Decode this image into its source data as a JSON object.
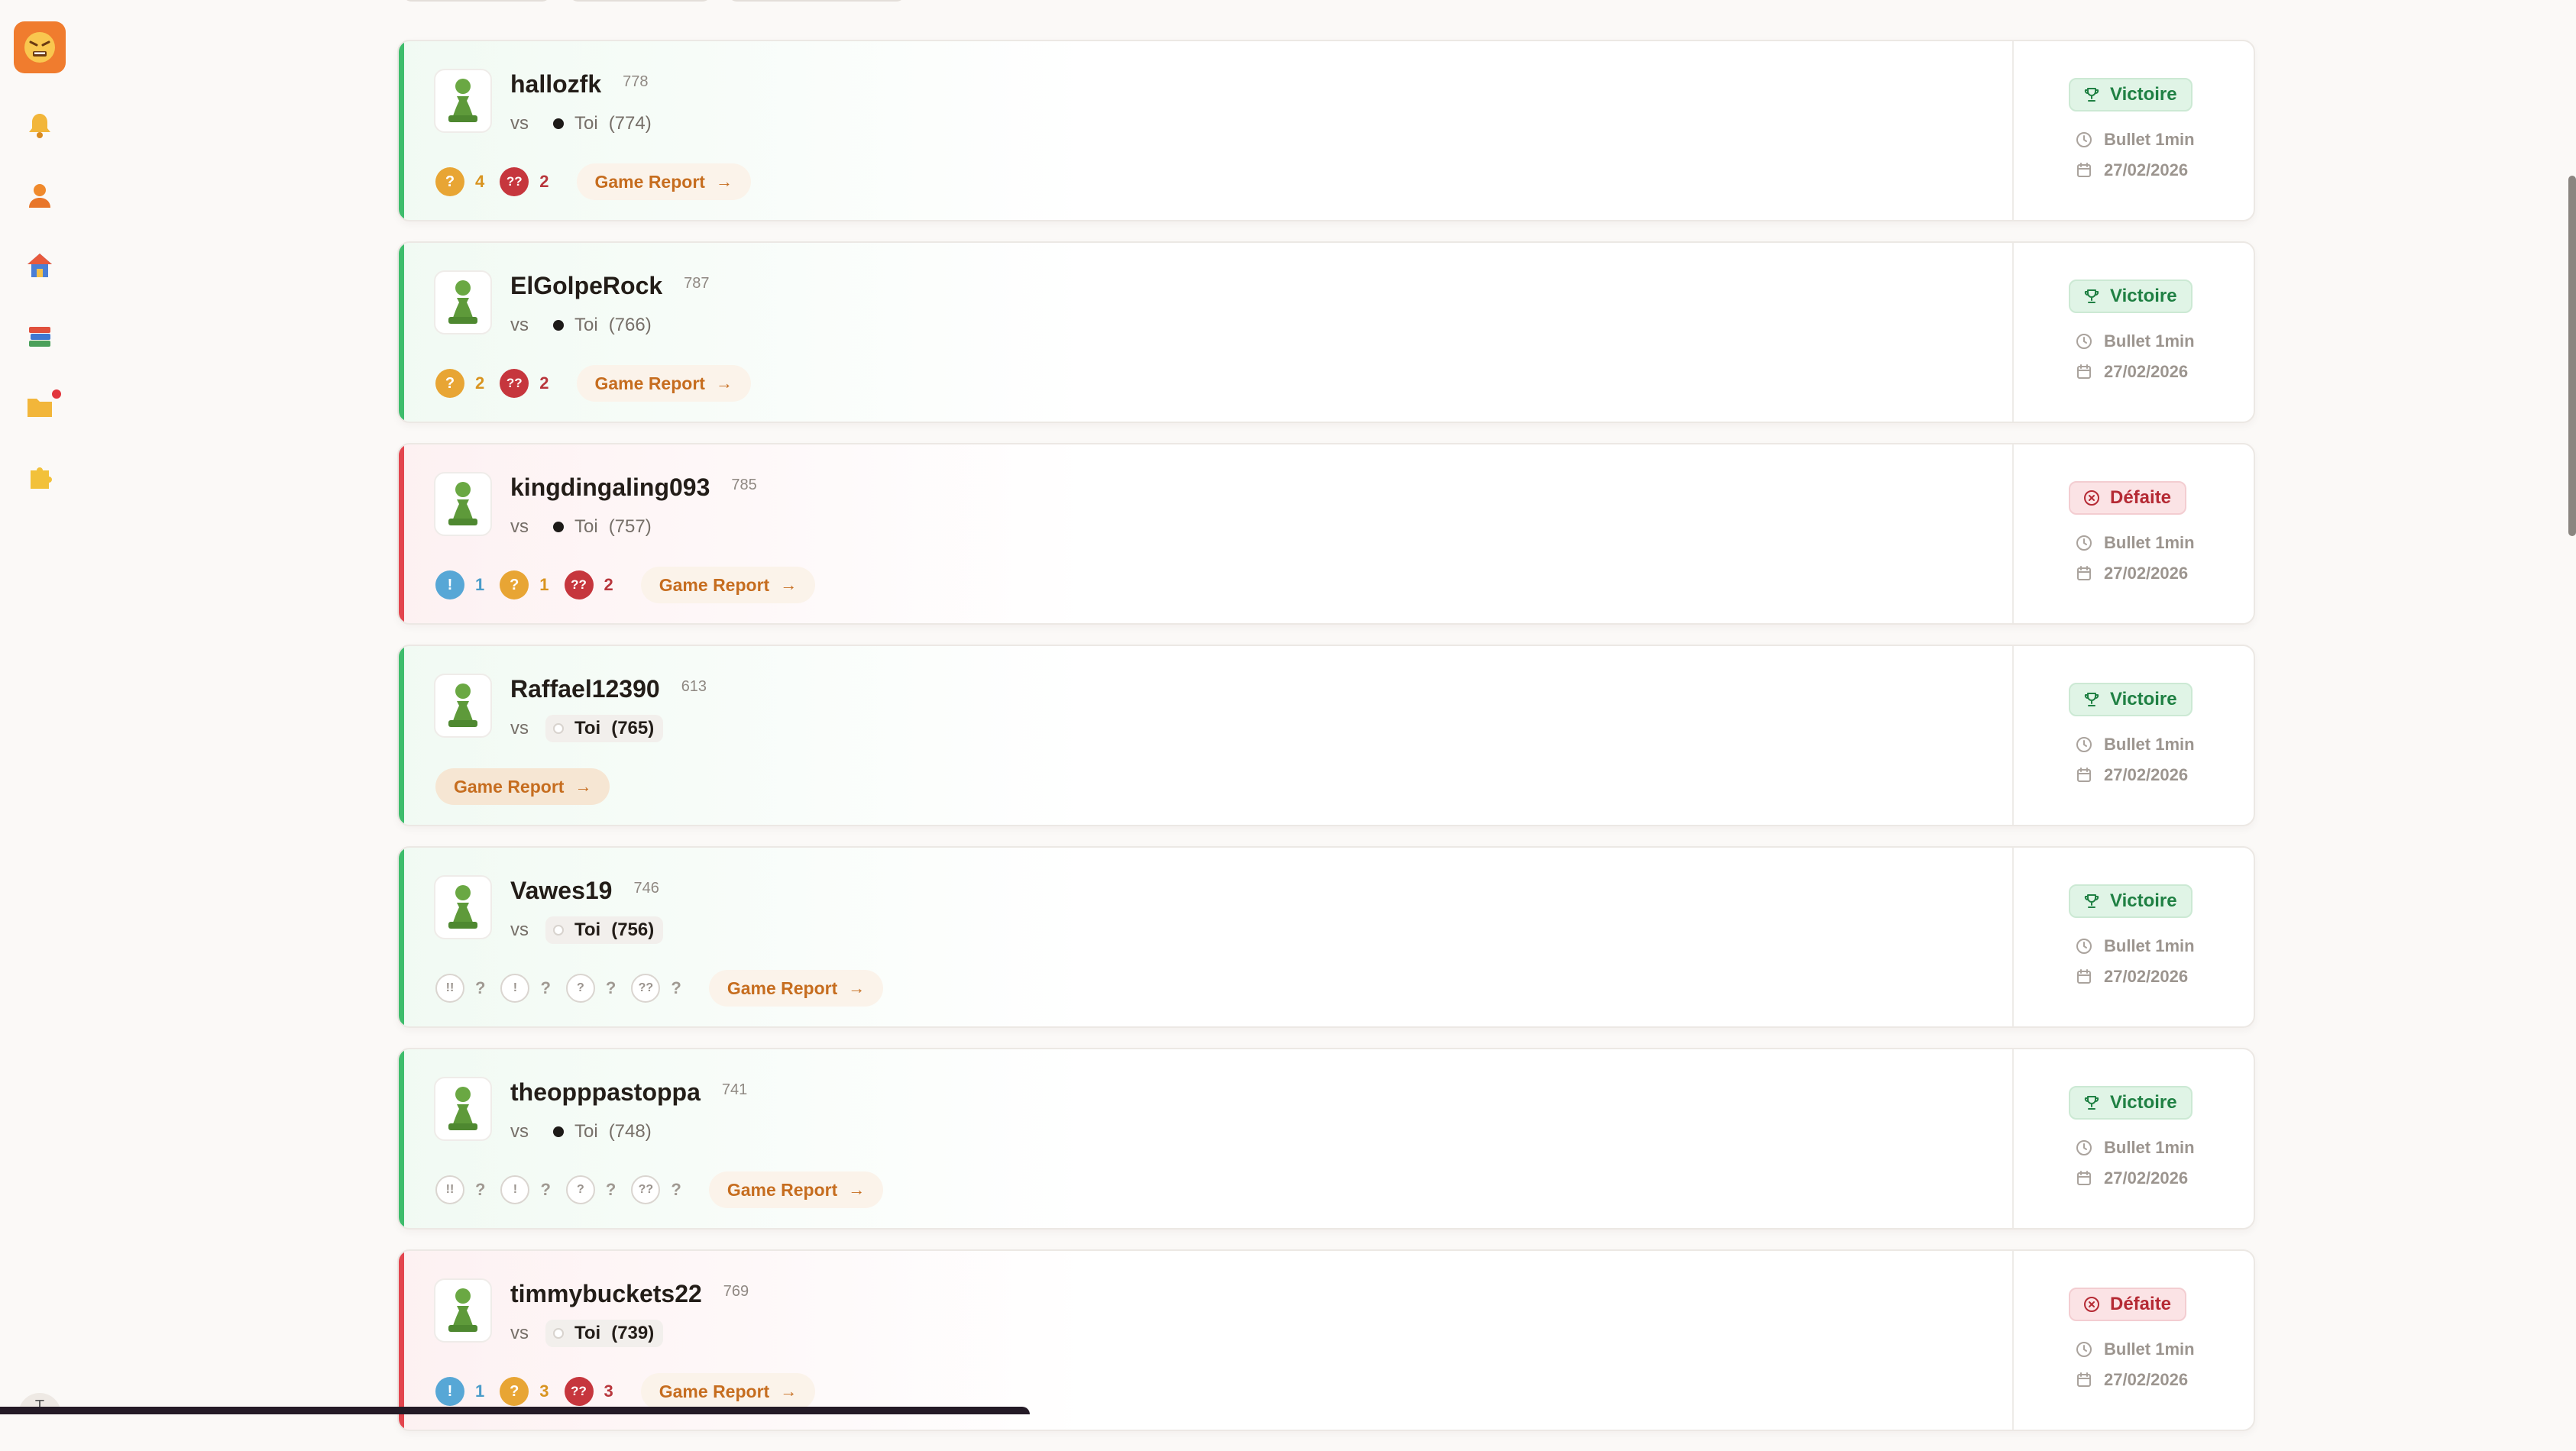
{
  "sidebar": {
    "items": [
      {
        "name": "notifications",
        "icon": "bell-icon"
      },
      {
        "name": "profile",
        "icon": "user-icon"
      },
      {
        "name": "home",
        "icon": "house-icon"
      },
      {
        "name": "library",
        "icon": "books-icon"
      },
      {
        "name": "folder",
        "icon": "folder-icon",
        "has_notification": true
      },
      {
        "name": "puzzles",
        "icon": "puzzle-icon"
      }
    ],
    "bottom_label": "T"
  },
  "colors": {
    "win": "#3ebd6c",
    "loss": "#e3454e",
    "accent": "#f07c2e",
    "report": "#c66d1f"
  },
  "games": [
    {
      "result": "win",
      "result_label": "Victoire",
      "opponent": "hallozfk",
      "opponent_rating": "778",
      "vs": "vs",
      "you_label": "Toi",
      "you_color": "black",
      "you_rating": "(774)",
      "stats": [
        {
          "type": "mistake",
          "symbol": "?",
          "count": "4"
        },
        {
          "type": "blunder",
          "symbol": "??",
          "count": "2"
        }
      ],
      "report_label": "Game Report",
      "mode": "Bullet 1min",
      "date": "27/02/2026"
    },
    {
      "result": "win",
      "result_label": "Victoire",
      "opponent": "ElGolpeRock",
      "opponent_rating": "787",
      "vs": "vs",
      "you_label": "Toi",
      "you_color": "black",
      "you_rating": "(766)",
      "stats": [
        {
          "type": "mistake",
          "symbol": "?",
          "count": "2"
        },
        {
          "type": "blunder",
          "symbol": "??",
          "count": "2"
        }
      ],
      "report_label": "Game Report",
      "mode": "Bullet 1min",
      "date": "27/02/2026"
    },
    {
      "result": "loss",
      "result_label": "Défaite",
      "opponent": "kingdingaling093",
      "opponent_rating": "785",
      "vs": "vs",
      "you_label": "Toi",
      "you_color": "black",
      "you_rating": "(757)",
      "stats": [
        {
          "type": "inacc",
          "symbol": "!",
          "count": "1"
        },
        {
          "type": "mistake",
          "symbol": "?",
          "count": "1"
        },
        {
          "type": "blunder",
          "symbol": "??",
          "count": "2"
        }
      ],
      "report_label": "Game Report",
      "mode": "Bullet 1min",
      "date": "27/02/2026"
    },
    {
      "result": "win",
      "result_label": "Victoire",
      "opponent": "Raffael12390",
      "opponent_rating": "613",
      "vs": "vs",
      "you_label": "Toi",
      "you_color": "white",
      "you_rating": "(765)",
      "stats": [],
      "report_label": "Game Report",
      "mode": "Bullet 1min",
      "date": "27/02/2026"
    },
    {
      "result": "win",
      "result_label": "Victoire",
      "opponent": "Vawes19",
      "opponent_rating": "746",
      "vs": "vs",
      "you_label": "Toi",
      "you_color": "white",
      "you_rating": "(756)",
      "stats": [
        {
          "type": "empty",
          "symbol": "!!",
          "count": "?"
        },
        {
          "type": "empty",
          "symbol": "!",
          "count": "?"
        },
        {
          "type": "empty",
          "symbol": "?",
          "count": "?"
        },
        {
          "type": "empty",
          "symbol": "??",
          "count": "?"
        }
      ],
      "report_label": "Game Report",
      "mode": "Bullet 1min",
      "date": "27/02/2026"
    },
    {
      "result": "win",
      "result_label": "Victoire",
      "opponent": "theopppastoppa",
      "opponent_rating": "741",
      "vs": "vs",
      "you_label": "Toi",
      "you_color": "black",
      "you_rating": "(748)",
      "stats": [
        {
          "type": "empty",
          "symbol": "!!",
          "count": "?"
        },
        {
          "type": "empty",
          "symbol": "!",
          "count": "?"
        },
        {
          "type": "empty",
          "symbol": "?",
          "count": "?"
        },
        {
          "type": "empty",
          "symbol": "??",
          "count": "?"
        }
      ],
      "report_label": "Game Report",
      "mode": "Bullet 1min",
      "date": "27/02/2026"
    },
    {
      "result": "loss",
      "result_label": "Défaite",
      "opponent": "timmybuckets22",
      "opponent_rating": "769",
      "vs": "vs",
      "you_label": "Toi",
      "you_color": "white",
      "you_rating": "(739)",
      "stats": [
        {
          "type": "inacc",
          "symbol": "!",
          "count": "1"
        },
        {
          "type": "mistake",
          "symbol": "?",
          "count": "3"
        },
        {
          "type": "blunder",
          "symbol": "??",
          "count": "3"
        }
      ],
      "report_label": "Game Report",
      "mode": "Bullet 1min",
      "date": "27/02/2026"
    }
  ]
}
